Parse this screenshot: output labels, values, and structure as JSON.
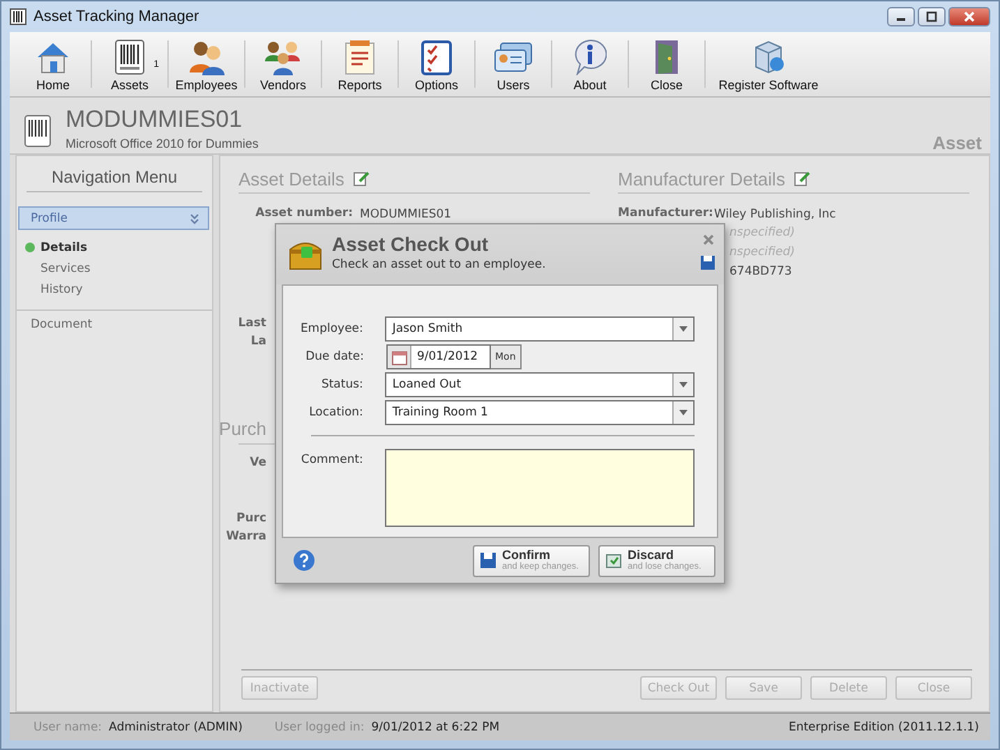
{
  "window": {
    "title": "Asset Tracking Manager"
  },
  "toolbar": [
    {
      "label": "Home"
    },
    {
      "label": "Assets",
      "badge": "1"
    },
    {
      "label": "Employees"
    },
    {
      "label": "Vendors"
    },
    {
      "label": "Reports"
    },
    {
      "label": "Options"
    },
    {
      "label": "Users"
    },
    {
      "label": "About"
    },
    {
      "label": "Close"
    },
    {
      "label": "Register Software"
    }
  ],
  "header": {
    "title": "MODUMMIES01",
    "subtitle": "Microsoft Office 2010 for Dummies",
    "section": "Asset"
  },
  "navigation": {
    "title": "Navigation Menu",
    "group": {
      "label": "Profile",
      "expanded": true
    },
    "items": [
      {
        "label": "Details",
        "selected": true
      },
      {
        "label": "Services",
        "selected": false
      },
      {
        "label": "History",
        "selected": false
      }
    ],
    "other": [
      {
        "label": "Document"
      }
    ]
  },
  "asset_details": {
    "title": "Asset Details",
    "number_label": "Asset number:",
    "number_value": "MODUMMIES01",
    "covered_labels": [
      "Last",
      "La"
    ]
  },
  "purchase": {
    "title": "Purch",
    "covered_labels": [
      "Ve"
    ],
    "covered_labels_2": [
      "Purc",
      "Warra"
    ]
  },
  "manufacturer_details": {
    "title": "Manufacturer Details",
    "label": "Manufacturer:",
    "value": "Wiley Publishing, Inc",
    "covered_values": [
      {
        "text": "nspecified)",
        "muted": true
      },
      {
        "text": "nspecified)",
        "muted": true
      },
      {
        "text": "674BD773",
        "muted": false
      }
    ]
  },
  "actions": [
    {
      "label": "Inactivate",
      "disabled": true
    },
    {
      "label": "Check Out",
      "disabled": true
    },
    {
      "label": "Save",
      "disabled": true
    },
    {
      "label": "Delete",
      "disabled": true
    },
    {
      "label": "Close",
      "disabled": true
    }
  ],
  "dialog": {
    "title": "Asset Check Out",
    "subtitle": "Check an asset out to an employee.",
    "fields": [
      {
        "kind": "dropdown",
        "label": "Employee:",
        "value": "Jason Smith"
      },
      {
        "kind": "date",
        "label": "Due date:",
        "value": "9/01/2012",
        "day": "Mon"
      },
      {
        "kind": "dropdown",
        "label": "Status:",
        "value": "Loaned Out"
      },
      {
        "kind": "dropdown",
        "label": "Location:",
        "value": "Training Room 1"
      }
    ],
    "comment_label": "Comment:",
    "buttons": [
      {
        "kind": "confirm",
        "label": "Confirm",
        "hint": "and keep changes."
      },
      {
        "kind": "discard",
        "label": "Discard",
        "hint": "and lose changes."
      }
    ]
  },
  "status_bar": {
    "user_label": "User name:",
    "user": "Administrator (ADMIN)",
    "login_label": "User logged in:",
    "login": "9/01/2012 at 6:22 PM",
    "edition": "Enterprise Edition (2011.12.1.1)"
  }
}
